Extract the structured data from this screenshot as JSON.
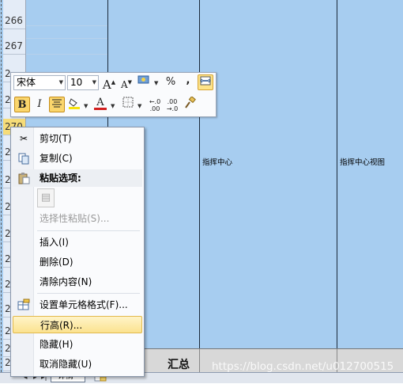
{
  "sheet": {
    "rows": [
      {
        "num": "266"
      },
      {
        "num": "267"
      },
      {
        "num": "2"
      },
      {
        "num": "2"
      },
      {
        "num": "270"
      },
      {
        "num": "2"
      },
      {
        "num": "2"
      },
      {
        "num": "2"
      },
      {
        "num": "2"
      },
      {
        "num": "2"
      },
      {
        "num": "2"
      },
      {
        "num": "2"
      },
      {
        "num": "2"
      },
      {
        "num": "2"
      },
      {
        "num": "2"
      },
      {
        "num": "2"
      }
    ],
    "cells": {
      "dispatch_center": "指挥中心",
      "dispatch_center_view": "指挥中心视图"
    },
    "summary_label": "汇总",
    "tab_label": "详情",
    "watermark": "https://blog.csdn.net/u012700515"
  },
  "minibar": {
    "font_name": "宋体",
    "font_size": "10",
    "grow_font": "A",
    "shrink_font": "A",
    "percent": "%",
    "comma": ",",
    "bold": "B",
    "italic": "I",
    "font_color_letter": "A",
    "inc_decimal": "+.0\n.00",
    "dec_decimal": ".00\n→.0",
    "accent_red": "#d21f1f",
    "accent_yellow": "#f7e20e"
  },
  "menu": {
    "items": [
      {
        "label": "剪切(T)",
        "icon": "scissors-icon"
      },
      {
        "label": "复制(C)",
        "icon": "copy-icon"
      },
      {
        "label": "粘贴选项:",
        "icon": "paste-icon"
      },
      {
        "label": "选择性粘贴(S)...",
        "icon": ""
      },
      {
        "label": "插入(I)",
        "icon": ""
      },
      {
        "label": "删除(D)",
        "icon": ""
      },
      {
        "label": "清除内容(N)",
        "icon": ""
      },
      {
        "label": "设置单元格格式(F)...",
        "icon": "format-cells-icon"
      },
      {
        "label": "行高(R)...",
        "icon": ""
      },
      {
        "label": "隐藏(H)",
        "icon": ""
      },
      {
        "label": "取消隐藏(U)",
        "icon": ""
      }
    ]
  }
}
